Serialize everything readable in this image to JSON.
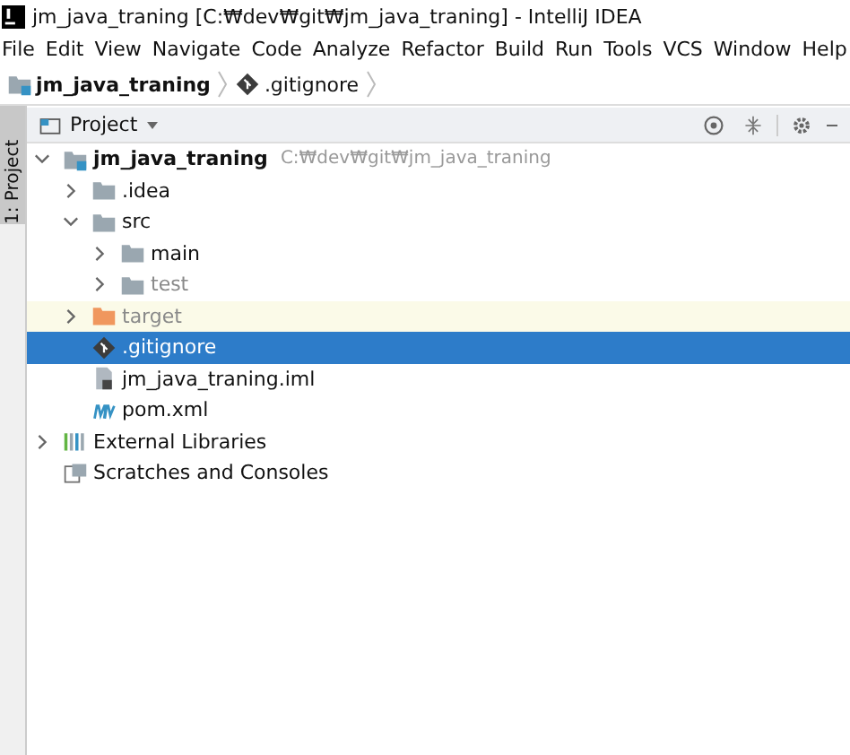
{
  "window": {
    "title": "jm_java_traning [C:₩dev₩git₩jm_java_traning] - IntelliJ IDEA"
  },
  "menu": [
    "File",
    "Edit",
    "View",
    "Navigate",
    "Code",
    "Analyze",
    "Refactor",
    "Build",
    "Run",
    "Tools",
    "VCS",
    "Window",
    "Help"
  ],
  "breadcrumb": [
    {
      "label": "jm_java_traning",
      "kind": "module"
    },
    {
      "label": ".gitignore",
      "kind": "git"
    }
  ],
  "side_tab": {
    "label": "1: Project",
    "selected": true
  },
  "panel": {
    "title": "Project"
  },
  "tree": [
    {
      "label": "jm_java_traning",
      "hint": "C:₩dev₩git₩jm_java_traning",
      "kind": "module",
      "expanded": true,
      "selected": false,
      "dimmed": false,
      "children": [
        {
          "label": ".idea",
          "kind": "folder",
          "expanded": false,
          "selected": false,
          "dimmed": false
        },
        {
          "label": "src",
          "kind": "folder",
          "expanded": true,
          "selected": false,
          "dimmed": false,
          "children": [
            {
              "label": "main",
              "kind": "folder",
              "expanded": false,
              "selected": false,
              "dimmed": false
            },
            {
              "label": "test",
              "kind": "folder",
              "expanded": false,
              "selected": false,
              "dimmed": true
            }
          ]
        },
        {
          "label": "target",
          "kind": "excluded",
          "expanded": false,
          "selected": false,
          "dimmed": true
        },
        {
          "label": ".gitignore",
          "kind": "git",
          "selected": true,
          "dimmed": false
        },
        {
          "label": "jm_java_traning.iml",
          "kind": "iml",
          "selected": false,
          "dimmed": false
        },
        {
          "label": "pom.xml",
          "kind": "maven",
          "selected": false,
          "dimmed": false
        }
      ]
    },
    {
      "label": "External Libraries",
      "kind": "libraries",
      "expanded": false,
      "selected": false,
      "dimmed": false
    },
    {
      "label": "Scratches and Consoles",
      "kind": "scratches",
      "selected": false,
      "dimmed": false
    }
  ]
}
